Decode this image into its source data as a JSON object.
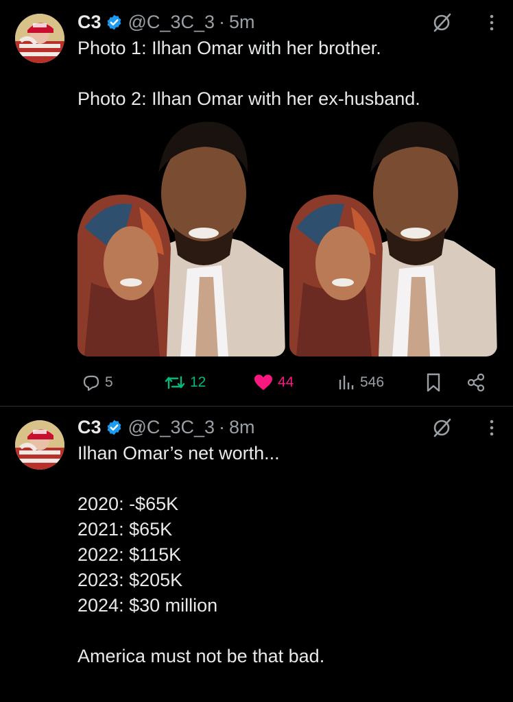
{
  "tweets": [
    {
      "author_name": "C3",
      "handle": "@C_3C_3",
      "separator": "·",
      "time": "5m",
      "text": "Photo 1: Ilhan Omar with her brother.\n\nPhoto 2: Ilhan Omar with her ex-husband.",
      "replies": "5",
      "reposts": "12",
      "likes": "44",
      "views": "546"
    },
    {
      "author_name": "C3",
      "handle": "@C_3C_3",
      "separator": "·",
      "time": "8m",
      "text": "Ilhan Omar’s net worth...\n\n2020: -$65K\n2021: $65K\n2022: $115K\n2023: $205K\n2024: $30 million\n\nAmerica must not be that bad."
    }
  ],
  "colors": {
    "background": "#000000",
    "text": "#e7e9ea",
    "muted": "#9aa0a6",
    "verified": "#1d9bf0",
    "repost": "#00ba7c",
    "like": "#f91880",
    "divider": "#2f3336"
  }
}
